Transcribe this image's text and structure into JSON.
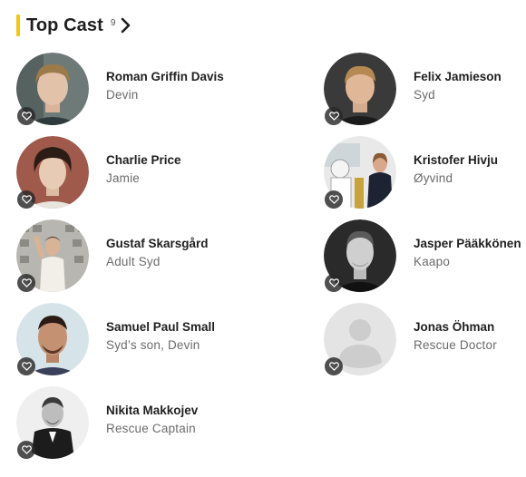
{
  "section": {
    "title": "Top Cast",
    "count": "9",
    "accent_color": "#f5c518"
  },
  "cast": [
    {
      "name": "Roman Griffin Davis",
      "role": "Devin",
      "photo": "young-man-light-hair"
    },
    {
      "name": "Felix Jamieson",
      "role": "Syd",
      "photo": "teen-boy-blond"
    },
    {
      "name": "Charlie Price",
      "role": "Jamie",
      "photo": "young-man-curly-hair"
    },
    {
      "name": "Kristofer Hivju",
      "role": "Øyvind",
      "photo": "man-event-suit"
    },
    {
      "name": "Gustaf Skarsgård",
      "role": "Adult Syd",
      "photo": "man-comic-con"
    },
    {
      "name": "Jasper Pääkkönen",
      "role": "Kaapo",
      "photo": "man-bw-portrait"
    },
    {
      "name": "Samuel Paul Small",
      "role": "Syd’s son, Devin",
      "photo": "young-man-headshot"
    },
    {
      "name": "Jonas Öhman",
      "role": "Rescue Doctor",
      "photo": "placeholder-person"
    },
    {
      "name": "Nikita Makkojev",
      "role": "Rescue Captain",
      "photo": "man-bw-suit"
    }
  ]
}
